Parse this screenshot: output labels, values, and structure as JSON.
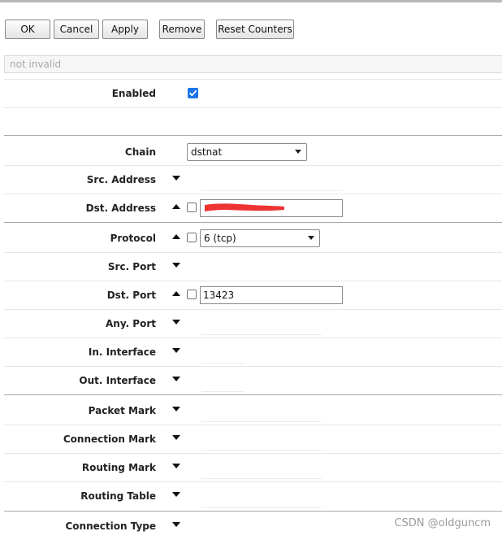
{
  "toolbar": {
    "ok": "OK",
    "cancel": "Cancel",
    "apply": "Apply",
    "remove": "Remove",
    "reset_counters": "Reset Counters"
  },
  "status": {
    "text": "not invalid"
  },
  "enabled": {
    "label": "Enabled",
    "checked": true
  },
  "chain": {
    "label": "Chain",
    "value": "dstnat"
  },
  "src_address": {
    "label": "Src. Address"
  },
  "dst_address": {
    "label": "Dst. Address",
    "value": ""
  },
  "protocol": {
    "label": "Protocol",
    "value": "6 (tcp)"
  },
  "src_port": {
    "label": "Src. Port"
  },
  "dst_port": {
    "label": "Dst. Port",
    "value": "13423"
  },
  "any_port": {
    "label": "Any. Port"
  },
  "in_interface": {
    "label": "In. Interface"
  },
  "out_interface": {
    "label": "Out. Interface"
  },
  "packet_mark": {
    "label": "Packet Mark"
  },
  "connection_mark": {
    "label": "Connection Mark"
  },
  "routing_mark": {
    "label": "Routing Mark"
  },
  "routing_table": {
    "label": "Routing Table"
  },
  "connection_type": {
    "label": "Connection Type"
  },
  "watermark": "CSDN @oldguncm",
  "colors": {
    "checkbox": "#1a73e8",
    "redaction": "#ee3333"
  }
}
